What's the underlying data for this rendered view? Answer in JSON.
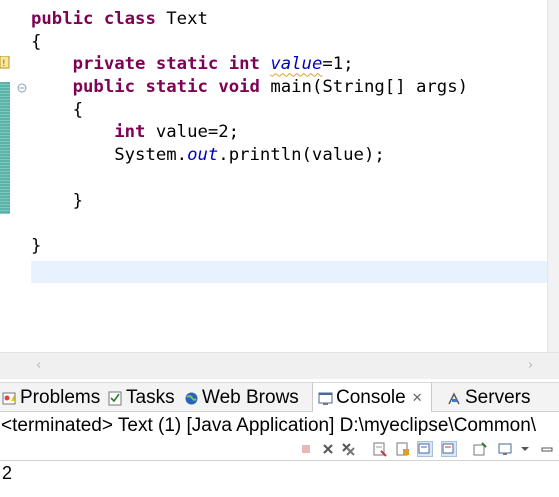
{
  "editor": {
    "lines": [
      [
        {
          "t": "public",
          "c": "kw"
        },
        {
          "t": " "
        },
        {
          "t": "class",
          "c": "kw"
        },
        {
          "t": " Text"
        }
      ],
      [
        {
          "t": "{"
        }
      ],
      [
        {
          "t": "    "
        },
        {
          "t": "private",
          "c": "kw"
        },
        {
          "t": " "
        },
        {
          "t": "static",
          "c": "kw"
        },
        {
          "t": " "
        },
        {
          "t": "int",
          "c": "kw"
        },
        {
          "t": " "
        },
        {
          "t": "value",
          "c": "fld squig"
        },
        {
          "t": "=1;"
        }
      ],
      [
        {
          "t": "    "
        },
        {
          "t": "public",
          "c": "kw"
        },
        {
          "t": " "
        },
        {
          "t": "static",
          "c": "kw"
        },
        {
          "t": " "
        },
        {
          "t": "void",
          "c": "kw"
        },
        {
          "t": " main(String[] args)"
        }
      ],
      [
        {
          "t": "    {"
        }
      ],
      [
        {
          "t": "        "
        },
        {
          "t": "int",
          "c": "kw"
        },
        {
          "t": " value=2;"
        }
      ],
      [
        {
          "t": "        System."
        },
        {
          "t": "out",
          "c": "fld"
        },
        {
          "t": ".println(value);"
        }
      ],
      [
        {
          "t": ""
        }
      ],
      [
        {
          "t": "    }"
        }
      ],
      [
        {
          "t": ""
        }
      ],
      [
        {
          "t": "}"
        }
      ]
    ]
  },
  "scrollbar": {
    "left_arrow": "‹",
    "right_arrow": "›"
  },
  "tabs": [
    {
      "label": "Problems",
      "icon": "problems-icon"
    },
    {
      "label": "Tasks",
      "icon": "tasks-icon"
    },
    {
      "label": "Web Brows",
      "icon": "web-browser-icon"
    },
    {
      "label": "Console",
      "icon": "console-icon",
      "active": true,
      "close": "✕"
    },
    {
      "label": "Servers",
      "icon": "servers-icon"
    }
  ],
  "console": {
    "status": "<terminated> Text (1) [Java Application] D:\\myeclipse\\Common\\",
    "output": "2"
  },
  "colors": {
    "keyword": "#7f0055",
    "field": "#0000c0",
    "current_line": "#e8f2fe",
    "change_bar": "#59b3a8"
  }
}
